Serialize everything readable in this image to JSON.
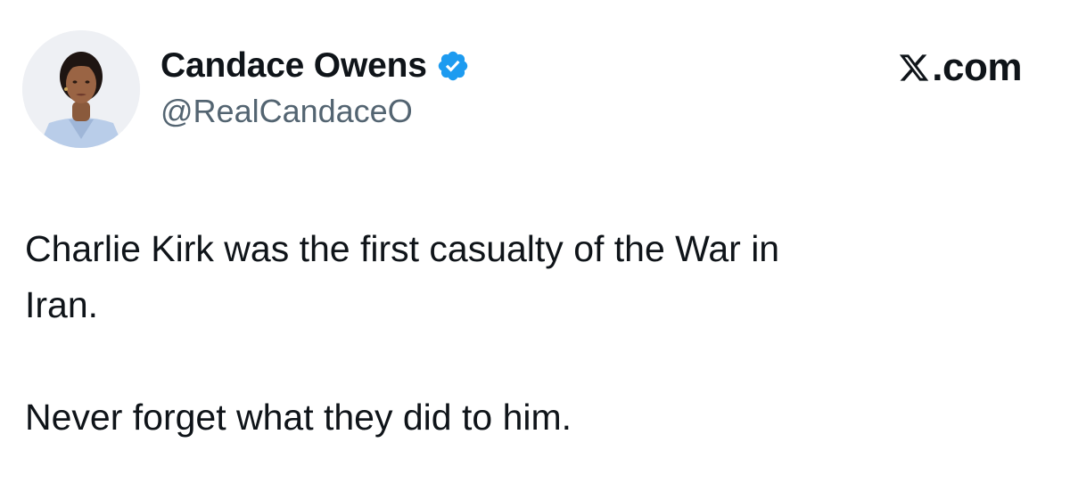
{
  "author": {
    "display_name": "Candace Owens",
    "handle": "@RealCandaceO",
    "verified": true,
    "verified_color": "#1d9bf0"
  },
  "brand": {
    "label": "com",
    "icon": "x-logo-icon"
  },
  "post": {
    "paragraphs": [
      "Charlie Kirk was the first casualty of the War in\nIran.",
      "Never forget what they did to him."
    ]
  }
}
